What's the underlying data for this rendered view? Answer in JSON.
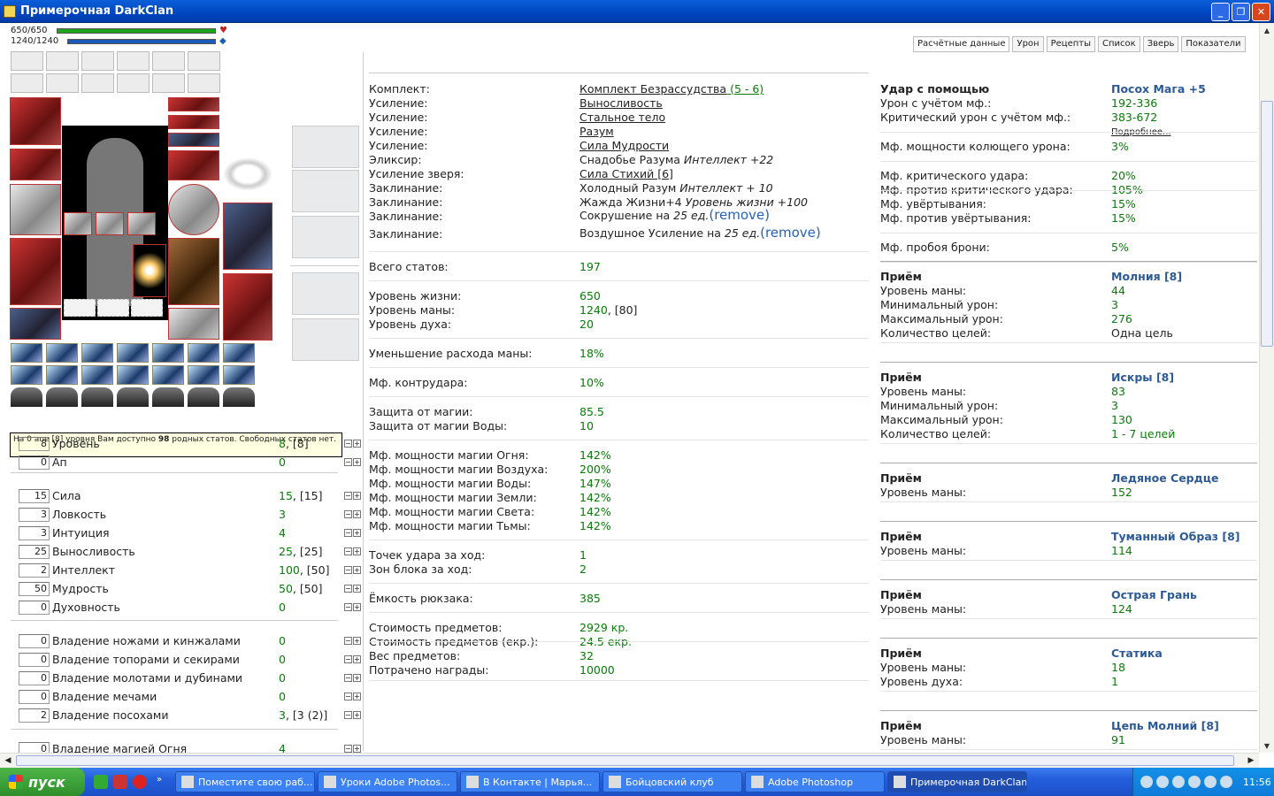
{
  "window": {
    "title": "Примерочная DarkClan"
  },
  "bars": {
    "hp": "650/650",
    "mp": "1240/1240",
    "hp_fraction": 1.0,
    "mp_fraction": 1.0
  },
  "tabs": [
    "Расчётные данные",
    "Урон",
    "Рецепты",
    "Список",
    "Зверь",
    "Показатели"
  ],
  "tooltip": {
    "pre": "На 0 апе [8] уровня Вам доступно ",
    "count": "98",
    "post": " родных статов. Свободных статов нет."
  },
  "stats": [
    {
      "input": "8",
      "name": "Уровень",
      "value": "8",
      "extra": ", [8]"
    },
    {
      "input": "0",
      "name": "Ап",
      "value": "0",
      "extra": ""
    },
    {
      "input": "15",
      "name": "Сила",
      "value": "15",
      "extra": ", [15]"
    },
    {
      "input": "3",
      "name": "Ловкость",
      "value": "3",
      "extra": ""
    },
    {
      "input": "3",
      "name": "Интуиция",
      "value": "4",
      "extra": ""
    },
    {
      "input": "25",
      "name": "Выносливость",
      "value": "25",
      "extra": ", [25]"
    },
    {
      "input": "2",
      "name": "Интеллект",
      "value": "100",
      "extra": ", [50]"
    },
    {
      "input": "50",
      "name": "Мудрость",
      "value": "50",
      "extra": ", [50]"
    },
    {
      "input": "0",
      "name": "Духовность",
      "value": "0",
      "extra": ""
    },
    {
      "input": "0",
      "name": "Владение ножами и кинжалами",
      "value": "0",
      "extra": ""
    },
    {
      "input": "0",
      "name": "Владение топорами и секирами",
      "value": "0",
      "extra": ""
    },
    {
      "input": "0",
      "name": "Владение молотами и дубинами",
      "value": "0",
      "extra": ""
    },
    {
      "input": "0",
      "name": "Владение мечами",
      "value": "0",
      "extra": ""
    },
    {
      "input": "2",
      "name": "Владение посохами",
      "value": "3",
      "extra": ", [3 (2)]"
    },
    {
      "input": "0",
      "name": "Владение магией Огня",
      "value": "4",
      "extra": ""
    }
  ],
  "details": [
    {
      "label": "Комплект:",
      "value": "Комплект Безрассудства",
      "suffix": " (5 - 6)",
      "link": true
    },
    {
      "label": "Усиление:",
      "value": "Выносливость",
      "link": true
    },
    {
      "label": "Усиление:",
      "value": "Стальное тело",
      "link": true
    },
    {
      "label": "Усиление:",
      "value": "Разум",
      "link": true
    },
    {
      "label": "Усиление:",
      "value": "Сила Мудрости",
      "link": true
    },
    {
      "label": "Эликсир:",
      "value": "Снадобье Разума ",
      "italic": "Интеллект +22"
    },
    {
      "label": "Усиление зверя:",
      "value": "Сила Стихий [6]",
      "link": true
    },
    {
      "label": "Заклинание:",
      "value": "Холодный Разум ",
      "italic": "Интеллект + 10"
    },
    {
      "label": "Заклинание:",
      "value": "Жажда Жизни+4 ",
      "italic": "Уровень жизни +100"
    },
    {
      "label": "Заклинание:",
      "value": "Сокрушение на ",
      "italic": "25 ед.",
      "remove": "(remove)"
    },
    {
      "label": "Заклинание:",
      "value": "Воздушное Усиление на ",
      "italic": "25 ед.",
      "remove": "(remove)"
    }
  ],
  "calc": [
    {
      "label": "Всего статов:",
      "value": "197"
    },
    {
      "label": "Уровень жизни:",
      "value": "650"
    },
    {
      "label": "Уровень маны:",
      "value": "1240",
      "extra": ", [80]"
    },
    {
      "label": "Уровень духа:",
      "value": "20"
    },
    {
      "label": "Уменьшение расхода маны:",
      "value": "18%"
    },
    {
      "label": "Мф. контрудара:",
      "value": "10%"
    },
    {
      "label": "Защита от магии:",
      "value": "85.5"
    },
    {
      "label": "Защита от магии Воды:",
      "value": "10"
    },
    {
      "label": "Мф. мощности магии Огня:",
      "value": "142%"
    },
    {
      "label": "Мф. мощности магии Воздуха:",
      "value": "200%"
    },
    {
      "label": "Мф. мощности магии Воды:",
      "value": "147%"
    },
    {
      "label": "Мф. мощности магии Земли:",
      "value": "142%"
    },
    {
      "label": "Мф. мощности магии Света:",
      "value": "142%"
    },
    {
      "label": "Мф. мощности магии Тьмы:",
      "value": "142%"
    },
    {
      "label": "Точек удара за ход:",
      "value": "1"
    },
    {
      "label": "Зон блока за ход:",
      "value": "2"
    },
    {
      "label": "Ёмкость рюкзака:",
      "value": "385"
    },
    {
      "label": "Стоимость предметов:",
      "value": "2929 кр."
    },
    {
      "label": "Стоимость предметов (екр.):",
      "value": "24.5 екр."
    },
    {
      "label": "Вес предметов:",
      "value": "32"
    },
    {
      "label": "Потрачено награды:",
      "value": "10000"
    }
  ],
  "attack": {
    "title": "Удар с помощью",
    "weapon": "Посох Мага +5",
    "rows": [
      {
        "label": "Урон с учётом мф.:",
        "value": "192-336"
      },
      {
        "label": "Критический урон с учётом мф.:",
        "value": "383-672"
      },
      {
        "label": "",
        "value": "Подробнее..."
      },
      {
        "label": "Мф. мощности колющего урона:",
        "value": "3%"
      },
      {
        "label": "Мф. критического удара:",
        "value": "20%"
      },
      {
        "label": "Мф. против критического удара:",
        "value": "105%"
      },
      {
        "label": "Мф. увёртывания:",
        "value": "15%"
      },
      {
        "label": "Мф. против увёртывания:",
        "value": "15%"
      },
      {
        "label": "Мф. пробоя брони:",
        "value": "5%"
      }
    ]
  },
  "skills": [
    {
      "head": "Приём",
      "name": "Молния [8]",
      "rows": [
        [
          "Уровень маны:",
          "44"
        ],
        [
          "Минимальный урон:",
          "3"
        ],
        [
          "Максимальный урон:",
          "276"
        ],
        [
          "Количество целей:",
          "Одна цель"
        ]
      ]
    },
    {
      "head": "Приём",
      "name": "Искры [8]",
      "rows": [
        [
          "Уровень маны:",
          "83"
        ],
        [
          "Минимальный урон:",
          "3"
        ],
        [
          "Максимальный урон:",
          "130"
        ],
        [
          "Количество целей:",
          "1 - 7 целей"
        ]
      ]
    },
    {
      "head": "Приём",
      "name": "Ледяное Сердце",
      "rows": [
        [
          "Уровень маны:",
          "152"
        ]
      ]
    },
    {
      "head": "Приём",
      "name": "Туманный Образ [8]",
      "rows": [
        [
          "Уровень маны:",
          "114"
        ]
      ]
    },
    {
      "head": "Приём",
      "name": "Острая Грань",
      "rows": [
        [
          "Уровень маны:",
          "124"
        ]
      ]
    },
    {
      "head": "Приём",
      "name": "Статика",
      "rows": [
        [
          "Уровень маны:",
          "18"
        ],
        [
          "Уровень духа:",
          "1"
        ]
      ]
    },
    {
      "head": "Приём",
      "name": "Цепь Молний [8]",
      "rows": [
        [
          "Уровень маны:",
          "91"
        ]
      ]
    }
  ],
  "taskbar": {
    "start": "пуск",
    "items": [
      "Поместите свою раб...",
      "Уроки Adobe Photos...",
      "В Контакте | Марья...",
      "Бойцовский клуб",
      "Adobe Photoshop",
      "Примерочная DarkClan"
    ],
    "clock": "11:56"
  },
  "colors": {
    "accent": "#2c5a96",
    "value_green": "#0a7a0a",
    "titlebar": "#0045c0"
  }
}
